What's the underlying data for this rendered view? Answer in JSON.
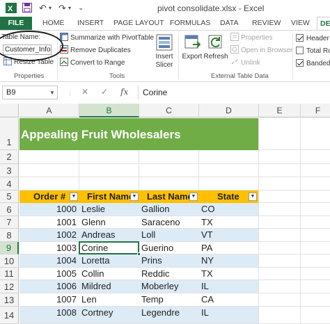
{
  "window": {
    "title": "pivot consolidate.xlsx - Excel"
  },
  "tabs": [
    "FILE",
    "HOME",
    "INSERT",
    "PAGE LAYOUT",
    "FORMULAS",
    "DATA",
    "REVIEW",
    "VIEW",
    "DE"
  ],
  "ribbon": {
    "properties": {
      "table_name_label": "Table Name:",
      "table_name_value": "Customer_Info",
      "resize_table": "Resize Table",
      "group_label": "Properties"
    },
    "tools": {
      "summarize": "Summarize with PivotTable",
      "remove_duplicates": "Remove Duplicates",
      "convert_to_range": "Convert to Range",
      "insert_slicer": "Insert Slicer",
      "group_label": "Tools"
    },
    "external": {
      "export": "Export",
      "refresh": "Refresh",
      "properties": "Properties",
      "open_in_browser": "Open in Browser",
      "unlink": "Unlink",
      "group_label": "External Table Data"
    },
    "style_options": {
      "header_row": "Header",
      "total_row": "Total Ro",
      "banded_rows": "Banded",
      "header_checked": true,
      "total_checked": false,
      "banded_checked": true
    }
  },
  "formula_bar": {
    "name_box": "B9",
    "formula": "Corine",
    "cancel": "✕",
    "enter": "✓",
    "fx": "fx"
  },
  "grid": {
    "columns": [
      "A",
      "B",
      "C",
      "D",
      "E",
      "F"
    ],
    "rows": [
      "1",
      "2",
      "3",
      "4",
      "5",
      "6",
      "7",
      "8",
      "9",
      "10",
      "11",
      "12",
      "13",
      "14"
    ],
    "selected_column": "B",
    "selected_row": "9"
  },
  "sheet": {
    "banner_title": "Appealing Fruit Wholesalers",
    "table_headers": [
      "Order #",
      "First Name",
      "Last Name",
      "State"
    ],
    "rows": [
      [
        "1000",
        "Leslie",
        "Gallion",
        "CO"
      ],
      [
        "1001",
        "Glenn",
        "Saraceno",
        "TX"
      ],
      [
        "1002",
        "Andreas",
        "Loll",
        "VT"
      ],
      [
        "1003",
        "Corine",
        "Guerino",
        "PA"
      ],
      [
        "1004",
        "Loretta",
        "Prins",
        "NY"
      ],
      [
        "1005",
        "Collin",
        "Reddic",
        "TX"
      ],
      [
        "1006",
        "Mildred",
        "Moberley",
        "IL"
      ],
      [
        "1007",
        "Len",
        "Temp",
        "CA"
      ],
      [
        "1008",
        "Cortney",
        "Legendre",
        "IL"
      ]
    ]
  },
  "colors": {
    "excel_green": "#217346",
    "banner_green": "#70ad47",
    "header_gold": "#ffc000",
    "band_blue": "#ddebf7"
  }
}
